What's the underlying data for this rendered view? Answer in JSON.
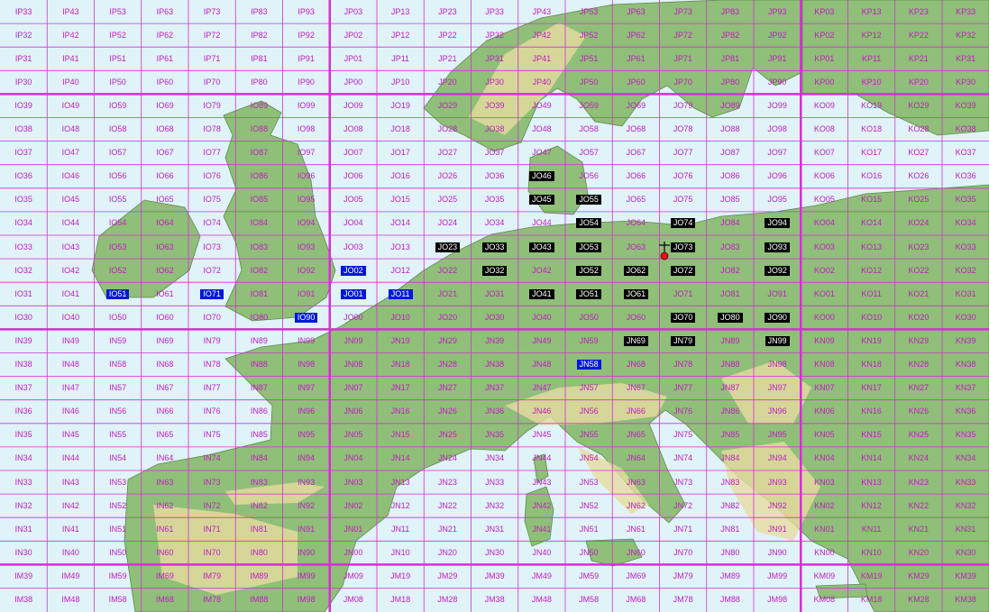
{
  "map": {
    "rows": [
      [
        "IP33",
        "IP43",
        "IP53",
        "IP63",
        "IP73",
        "IP83",
        "IP93",
        "JP03",
        "JP13",
        "JP23",
        "JP33",
        "JP43",
        "JP53",
        "JP63",
        "JP73",
        "JP83",
        "JP93",
        "KP03",
        "KP13",
        "KP23",
        "KP33"
      ],
      [
        "IP32",
        "IP42",
        "IP52",
        "IP62",
        "IP72",
        "IP82",
        "IP92",
        "JP02",
        "JP12",
        "JP22",
        "JP32",
        "JP42",
        "JP52",
        "JP62",
        "JP72",
        "JP82",
        "JP92",
        "KP02",
        "KP12",
        "KP22",
        "KP32"
      ],
      [
        "IP31",
        "IP41",
        "IP51",
        "IP61",
        "IP71",
        "IP81",
        "IP91",
        "JP01",
        "JP11",
        "JP21",
        "JP31",
        "JP41",
        "JP51",
        "JP61",
        "JP71",
        "JP81",
        "JP91",
        "KP01",
        "KP11",
        "KP21",
        "KP31"
      ],
      [
        "IP30",
        "IP40",
        "IP50",
        "IP60",
        "IP70",
        "IP80",
        "IP90",
        "JP00",
        "JP10",
        "JP20",
        "JP30",
        "JP40",
        "JP50",
        "JP60",
        "JP70",
        "JP80",
        "JP90",
        "KP00",
        "KP10",
        "KP20",
        "KP30"
      ],
      [
        "IO39",
        "IO49",
        "IO59",
        "IO69",
        "IO79",
        "IO89",
        "IO99",
        "JO09",
        "JO19",
        "JO29",
        "JO39",
        "JO49",
        "JO59",
        "JO69",
        "JO79",
        "JO89",
        "JO99",
        "KO09",
        "KO19",
        "KO29",
        "KO39"
      ],
      [
        "IO38",
        "IO48",
        "IO58",
        "IO68",
        "IO78",
        "IO88",
        "IO98",
        "JO08",
        "JO18",
        "JO28",
        "JO38",
        "JO48",
        "JO58",
        "JO68",
        "JO78",
        "JO88",
        "JO98",
        "KO08",
        "KO18",
        "KO28",
        "KO38"
      ],
      [
        "IO37",
        "IO47",
        "IO57",
        "IO67",
        "IO77",
        "IO87",
        "IO97",
        "JO07",
        "JO17",
        "JO27",
        "JO37",
        "JO47",
        "JO57",
        "JO67",
        "JO77",
        "JO87",
        "JO97",
        "KO07",
        "KO17",
        "KO27",
        "KO37"
      ],
      [
        "IO36",
        "IO46",
        "IO56",
        "IO66",
        "IO76",
        "IO86",
        "IO96",
        "JO06",
        "JO16",
        "JO26",
        "JO36",
        "JO46",
        "JO56",
        "JO66",
        "JO76",
        "JO86",
        "JO96",
        "KO06",
        "KO16",
        "KO26",
        "KO36"
      ],
      [
        "IO35",
        "IO45",
        "IO55",
        "IO65",
        "IO75",
        "IO85",
        "IO95",
        "JO05",
        "JO15",
        "JO25",
        "JO35",
        "JO45",
        "JO55",
        "JO65",
        "JO75",
        "JO85",
        "JO95",
        "KO05",
        "KO15",
        "KO25",
        "KO35"
      ],
      [
        "IO34",
        "IO44",
        "IO54",
        "IO64",
        "IO74",
        "IO84",
        "IO94",
        "JO04",
        "JO14",
        "JO24",
        "JO34",
        "JO44",
        "JO54",
        "JO64",
        "JO74",
        "JO84",
        "JO94",
        "KO04",
        "KO14",
        "KO24",
        "KO34"
      ],
      [
        "IO33",
        "IO43",
        "IO53",
        "IO63",
        "IO73",
        "IO83",
        "IO93",
        "JO03",
        "JO13",
        "JO23",
        "JO33",
        "JO43",
        "JO53",
        "JO63",
        "JO73",
        "JO83",
        "JO93",
        "KO03",
        "KO13",
        "KO23",
        "KO33"
      ],
      [
        "IO32",
        "IO42",
        "IO52",
        "IO62",
        "IO72",
        "IO82",
        "IO92",
        "JO02",
        "JO12",
        "JO22",
        "JO32",
        "JO42",
        "JO52",
        "JO62",
        "JO72",
        "JO82",
        "JO92",
        "KO02",
        "KO12",
        "KO22",
        "KO32"
      ],
      [
        "IO31",
        "IO41",
        "IO51",
        "IO61",
        "IO71",
        "IO81",
        "IO91",
        "JO01",
        "JO11",
        "JO21",
        "JO31",
        "JO41",
        "JO51",
        "JO61",
        "JO71",
        "JO81",
        "JO91",
        "KO01",
        "KO11",
        "KO21",
        "KO31"
      ],
      [
        "IO30",
        "IO40",
        "IO50",
        "IO60",
        "IO70",
        "IO80",
        "IO90",
        "JO00",
        "JO10",
        "JO20",
        "JO30",
        "JO40",
        "JO50",
        "JO60",
        "JO70",
        "JO80",
        "JO90",
        "KO00",
        "KO10",
        "KO20",
        "KO30"
      ],
      [
        "IN39",
        "IN49",
        "IN59",
        "IN69",
        "IN79",
        "IN89",
        "IN99",
        "JN09",
        "JN19",
        "JN29",
        "JN39",
        "JN49",
        "JN59",
        "JN69",
        "JN79",
        "JN89",
        "JN99",
        "KN09",
        "KN19",
        "KN29",
        "KN39"
      ],
      [
        "IN38",
        "IN48",
        "IN58",
        "IN68",
        "IN78",
        "IN88",
        "IN98",
        "JN08",
        "JN18",
        "JN28",
        "JN38",
        "JN48",
        "JN58",
        "JN68",
        "JN78",
        "JN88",
        "JN98",
        "KN08",
        "KN18",
        "KN28",
        "KN38"
      ],
      [
        "IN37",
        "IN47",
        "IN57",
        "IN67",
        "IN77",
        "IN87",
        "IN97",
        "JN07",
        "JN17",
        "JN27",
        "JN37",
        "JN47",
        "JN57",
        "JN67",
        "JN77",
        "JN87",
        "JN97",
        "KN07",
        "KN17",
        "KN27",
        "KN37"
      ],
      [
        "IN36",
        "IN46",
        "IN56",
        "IN66",
        "IN76",
        "IN86",
        "IN96",
        "JN06",
        "JN16",
        "JN26",
        "JN36",
        "JN46",
        "JN56",
        "JN66",
        "JN76",
        "JN86",
        "JN96",
        "KN06",
        "KN16",
        "KN26",
        "KN36"
      ],
      [
        "IN35",
        "IN45",
        "IN55",
        "IN65",
        "IN75",
        "IN85",
        "IN95",
        "JN05",
        "JN15",
        "JN25",
        "JN35",
        "JN45",
        "JN55",
        "JN65",
        "JN75",
        "JN85",
        "JN95",
        "KN05",
        "KN15",
        "KN25",
        "KN35"
      ],
      [
        "IN34",
        "IN44",
        "IN54",
        "IN64",
        "IN74",
        "IN84",
        "IN94",
        "JN04",
        "JN14",
        "JN24",
        "JN34",
        "JN44",
        "JN54",
        "JN64",
        "JN74",
        "JN84",
        "JN94",
        "KN04",
        "KN14",
        "KN24",
        "KN34"
      ],
      [
        "IN33",
        "IN43",
        "IN53",
        "IN63",
        "IN73",
        "IN83",
        "IN93",
        "JN03",
        "JN13",
        "JN23",
        "JN33",
        "JN43",
        "JN53",
        "JN63",
        "JN73",
        "JN83",
        "JN93",
        "KN03",
        "KN13",
        "KN23",
        "KN33"
      ],
      [
        "IN32",
        "IN42",
        "IN52",
        "IN62",
        "IN72",
        "IN82",
        "IN92",
        "JN02",
        "JN12",
        "JN22",
        "JN32",
        "JN42",
        "JN52",
        "JN62",
        "JN72",
        "JN82",
        "JN92",
        "KN02",
        "KN12",
        "KN22",
        "KN32"
      ],
      [
        "IN31",
        "IN41",
        "IN51",
        "IN61",
        "IN71",
        "IN81",
        "IN91",
        "JN01",
        "JN11",
        "JN21",
        "JN31",
        "JN41",
        "JN51",
        "JN61",
        "JN71",
        "JN81",
        "JN91",
        "KN01",
        "KN11",
        "KN21",
        "KN31"
      ],
      [
        "IN30",
        "IN40",
        "IN50",
        "IN60",
        "IN70",
        "IN80",
        "IN90",
        "JN00",
        "JN10",
        "JN20",
        "JN30",
        "JN40",
        "JN50",
        "JN60",
        "JN70",
        "JN80",
        "JN90",
        "KN00",
        "KN10",
        "KN20",
        "KN30"
      ],
      [
        "IM39",
        "IM49",
        "IM59",
        "IM69",
        "IM79",
        "IM89",
        "IM99",
        "JM09",
        "JM19",
        "JM29",
        "JM39",
        "JM49",
        "JM59",
        "JM69",
        "JM79",
        "JM89",
        "JM99",
        "KM09",
        "KM19",
        "KM29",
        "KM39"
      ],
      [
        "IM38",
        "IM48",
        "IM58",
        "IM68",
        "IM78",
        "IM88",
        "IM98",
        "JM08",
        "JM18",
        "JM28",
        "JM38",
        "JM48",
        "JM58",
        "JM68",
        "JM78",
        "JM88",
        "JM98",
        "KM08",
        "KM18",
        "KM28",
        "KM38"
      ]
    ],
    "highlighted_black": [
      "JO46",
      "JO45",
      "JO55",
      "JO54",
      "JO74",
      "JO94",
      "JO23",
      "JO33",
      "JO43",
      "JO53",
      "JO73",
      "JO93",
      "JO32",
      "JO52",
      "JO62",
      "JO72",
      "JO92",
      "JO41",
      "JO51",
      "JO61",
      "JO70",
      "JO80",
      "JO90",
      "JN69",
      "JN79",
      "JN99"
    ],
    "highlighted_blue": [
      "JO02",
      "IO51",
      "IO71",
      "JO01",
      "JO11",
      "IO90",
      "JN58"
    ],
    "colors": {
      "sea": "#dff3f8",
      "land": "#8fbf78",
      "highland": "#e6dca0",
      "grid": "#d430d4",
      "label": "#c21cc2",
      "highlight_black": "#000000",
      "highlight_blue": "#0018d8",
      "marker": "#e8101c"
    }
  }
}
